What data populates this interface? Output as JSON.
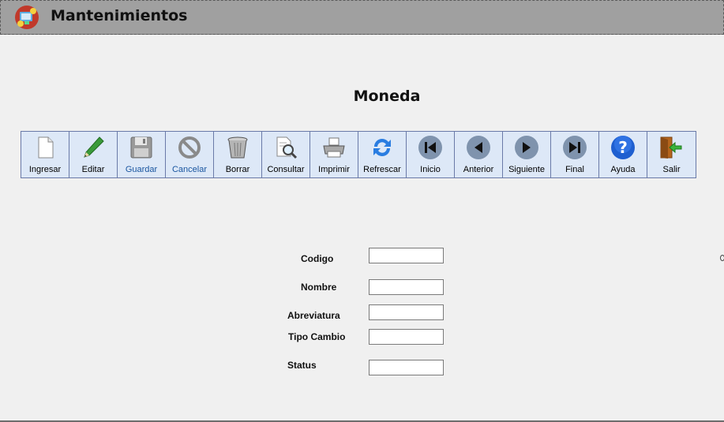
{
  "window": {
    "title": "Mantenimientos",
    "app_icon": "maintenance-icon"
  },
  "form": {
    "title": "Moneda"
  },
  "toolbar": {
    "buttons": [
      {
        "label": "Ingresar",
        "icon": "new-document-icon",
        "enabled": true
      },
      {
        "label": "Editar",
        "icon": "pencil-icon",
        "enabled": true
      },
      {
        "label": "Guardar",
        "icon": "floppy-disk-icon",
        "enabled": false
      },
      {
        "label": "Cancelar",
        "icon": "cancel-icon",
        "enabled": false
      },
      {
        "label": "Borrar",
        "icon": "trash-icon",
        "enabled": true
      },
      {
        "label": "Consultar",
        "icon": "search-document-icon",
        "enabled": true
      },
      {
        "label": "Imprimir",
        "icon": "printer-icon",
        "enabled": true
      },
      {
        "label": "Refrescar",
        "icon": "refresh-icon",
        "enabled": true
      },
      {
        "label": "Inicio",
        "icon": "first-record-icon",
        "enabled": true
      },
      {
        "label": "Anterior",
        "icon": "previous-record-icon",
        "enabled": true
      },
      {
        "label": "Siguiente",
        "icon": "next-record-icon",
        "enabled": true
      },
      {
        "label": "Final",
        "icon": "last-record-icon",
        "enabled": true
      },
      {
        "label": "Ayuda",
        "icon": "help-icon",
        "enabled": true
      },
      {
        "label": "Salir",
        "icon": "exit-icon",
        "enabled": true
      }
    ]
  },
  "fields": [
    {
      "label": "Codigo",
      "value": ""
    },
    {
      "label": "Nombre",
      "value": ""
    },
    {
      "label": "Abreviatura",
      "value": ""
    },
    {
      "label": "Tipo Cambio",
      "value": ""
    },
    {
      "label": "Status",
      "value": ""
    }
  ],
  "colors": {
    "titlebar": "#a0a0a0",
    "toolbar_button": "#dde8f7",
    "nav_circle": "#7f93ad",
    "help_blue": "#1f5fd0"
  }
}
